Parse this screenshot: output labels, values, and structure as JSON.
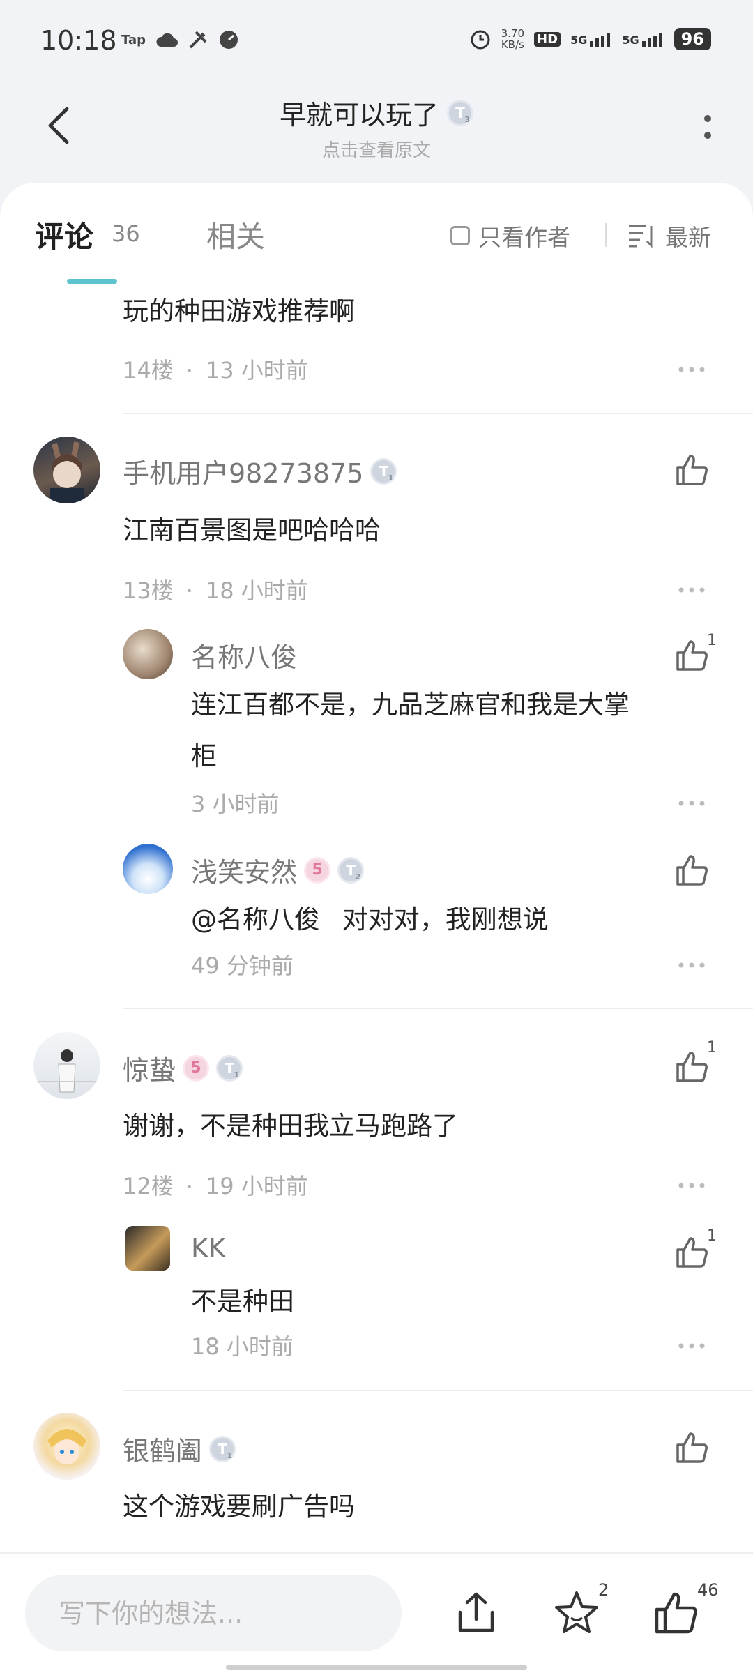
{
  "status_bar": {
    "time": "10:18",
    "tap_label": "Tap",
    "net_speed_value": "3.70",
    "net_speed_unit": "KB/s",
    "hd_label": "HD",
    "signal1": "5G",
    "signal2": "5G",
    "battery": "96"
  },
  "header": {
    "title": "早就可以玩了",
    "title_badge": "T",
    "title_badge_level": "3",
    "subtitle": "点击查看原文"
  },
  "tabs": {
    "comment_label": "评论",
    "comment_count": "36",
    "related_label": "相关",
    "author_only_label": "只看作者",
    "sort_label": "最新"
  },
  "comments": [
    {
      "text": "玩的种田游戏推荐啊",
      "floor": "14楼",
      "time": "13 小时前"
    },
    {
      "name": "手机用户98273875",
      "badge_level": "1",
      "text": "江南百景图是吧哈哈哈",
      "floor": "13楼",
      "time": "18 小时前",
      "replies": [
        {
          "name": "名称八俊",
          "text_line1": "连江百都不是，九品芝麻官和我是大掌",
          "text_line2": "柜",
          "time": "3 小时前",
          "likes": "1"
        },
        {
          "name": "浅笑安然",
          "badge_lv": "5",
          "badge_level": "2",
          "mention": "@名称八俊",
          "text": "对对对，我刚想说",
          "time": "49 分钟前"
        }
      ]
    },
    {
      "name": "惊蛰",
      "badge_lv": "5",
      "badge_level": "1",
      "text": "谢谢，不是种田我立马跑路了",
      "floor": "12楼",
      "time": "19 小时前",
      "likes": "1",
      "replies": [
        {
          "name": "KK",
          "text": "不是种田",
          "time": "18 小时前",
          "likes": "1"
        }
      ]
    },
    {
      "name": "银鹤阖",
      "badge_level": "1",
      "text": "这个游戏要刷广告吗"
    }
  ],
  "bottom_bar": {
    "input_placeholder": "写下你的想法...",
    "favorite_count": "2",
    "like_count": "46"
  }
}
